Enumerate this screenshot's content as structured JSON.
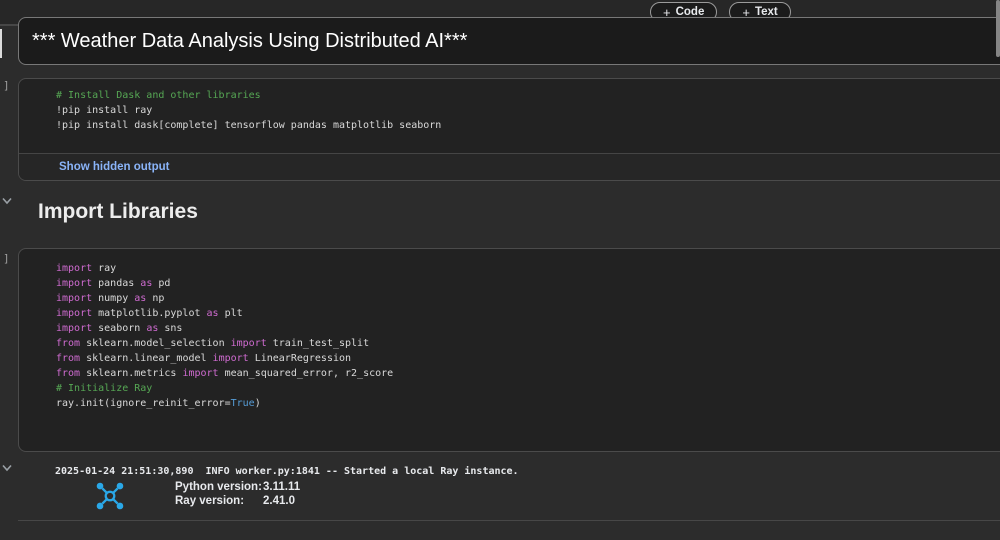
{
  "toolbar": {
    "plus": "+",
    "add_code_label": "Code",
    "add_text_label": "Text"
  },
  "title_cell": {
    "text": "*** Weather Data Analysis Using Distributed AI***"
  },
  "install_cell": {
    "gutter": "]",
    "show_hidden_output": "Show hidden output",
    "lines": [
      [
        {
          "t": "# Install Dask and other libraries",
          "c": "comment"
        }
      ],
      [
        {
          "t": "!pip install ray",
          "c": "plain"
        }
      ],
      [
        {
          "t": "!pip install dask[complete] tensorflow pandas matplotlib seaborn",
          "c": "plain"
        }
      ]
    ]
  },
  "section": {
    "heading": "Import Libraries"
  },
  "import_cell": {
    "gutter": "]",
    "lines": [
      [
        {
          "t": "import",
          "c": "keyword"
        },
        {
          "t": " ray",
          "c": "plain"
        }
      ],
      [
        {
          "t": "import",
          "c": "keyword"
        },
        {
          "t": " pandas ",
          "c": "plain"
        },
        {
          "t": "as",
          "c": "keyword"
        },
        {
          "t": " pd",
          "c": "plain"
        }
      ],
      [
        {
          "t": "import",
          "c": "keyword"
        },
        {
          "t": " numpy ",
          "c": "plain"
        },
        {
          "t": "as",
          "c": "keyword"
        },
        {
          "t": " np",
          "c": "plain"
        }
      ],
      [
        {
          "t": "import",
          "c": "keyword"
        },
        {
          "t": " matplotlib.pyplot ",
          "c": "plain"
        },
        {
          "t": "as",
          "c": "keyword"
        },
        {
          "t": " plt",
          "c": "plain"
        }
      ],
      [
        {
          "t": "import",
          "c": "keyword"
        },
        {
          "t": " seaborn ",
          "c": "plain"
        },
        {
          "t": "as",
          "c": "keyword"
        },
        {
          "t": " sns",
          "c": "plain"
        }
      ],
      [
        {
          "t": "from",
          "c": "keyword"
        },
        {
          "t": " sklearn.model_selection ",
          "c": "plain"
        },
        {
          "t": "import",
          "c": "keyword"
        },
        {
          "t": " train_test_split",
          "c": "plain"
        }
      ],
      [
        {
          "t": "from",
          "c": "keyword"
        },
        {
          "t": " sklearn.linear_model ",
          "c": "plain"
        },
        {
          "t": "import",
          "c": "keyword"
        },
        {
          "t": " LinearRegression",
          "c": "plain"
        }
      ],
      [
        {
          "t": "from",
          "c": "keyword"
        },
        {
          "t": " sklearn.metrics ",
          "c": "plain"
        },
        {
          "t": "import",
          "c": "keyword"
        },
        {
          "t": " mean_squared_error, r2_score",
          "c": "plain"
        }
      ],
      [
        {
          "t": "# Initialize Ray",
          "c": "comment"
        }
      ],
      [
        {
          "t": "ray.init(ignore_reinit_error=",
          "c": "plain"
        },
        {
          "t": "True",
          "c": "bool"
        },
        {
          "t": ")",
          "c": "plain"
        }
      ]
    ]
  },
  "output": {
    "log_line": "2025-01-24 21:51:30,890  INFO worker.py:1841 -- Started a local Ray instance.",
    "rows": [
      {
        "label": "Python version:",
        "value": "3.11.11"
      },
      {
        "label": "Ray version:",
        "value": "2.41.0"
      }
    ]
  },
  "colors": {
    "accent_blue": "#8ab4f8",
    "ray_logo_blue": "#2aa8e8",
    "comment_green": "#56a754",
    "keyword_pink": "#cf6bd0",
    "bool_blue": "#569cd6"
  }
}
